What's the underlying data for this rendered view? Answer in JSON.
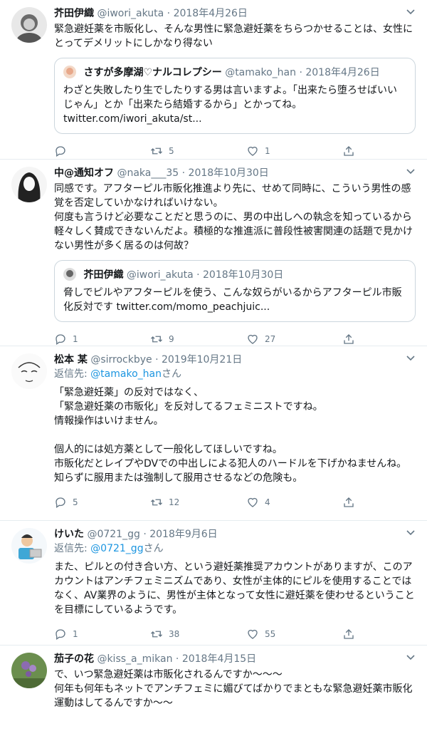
{
  "colors": {
    "text": "#14171a",
    "muted": "#657786",
    "link": "#1b95e0",
    "border": "#e6ecf0"
  },
  "tweets": [
    {
      "name": "芥田伊織",
      "handle": "@iwori_akuta",
      "date": "2018年4月26日",
      "reply_to": null,
      "body": "緊急避妊薬を市販化し、そんな男性に緊急避妊薬をちらつかせることは、女性にとってデメリットにしかなり得ない",
      "quote": {
        "name": "さすが多摩湖♡ナルコレプシー",
        "handle": "@tamako_han",
        "date": "2018年4月26日",
        "body": "わざと失敗したり生でしたりする男は言いますよ。「出来たら堕ろせばいいじゃん」とか「出来たら結婚するから」とかってね。\ntwitter.com/iwori_akuta/st..."
      },
      "counts": {
        "reply": "",
        "retweet": "5",
        "like": "1"
      }
    },
    {
      "name": "中@通知オフ",
      "handle": "@naka___35",
      "date": "2018年10月30日",
      "reply_to": null,
      "body": "同感です。アフターピル市販化推進より先に、せめて同時に、こういう男性の感覚を否定していかなければいけない。\n何度も言うけど必要なことだと思うのに、男の中出しへの執念を知っているから軽々しく賛成できないんだよ。積極的な推進派に普段性被害関連の話題で見かけない男性が多く居るのは何故？",
      "quote": {
        "name": "芥田伊織",
        "handle": "@iwori_akuta",
        "date": "2018年10月30日",
        "body": "脅しでピルやアフターピルを使う、こんな奴らがいるからアフターピル市販化反対です twitter.com/momo_peachjuic..."
      },
      "counts": {
        "reply": "1",
        "retweet": "9",
        "like": "27"
      }
    },
    {
      "name": "松本 某",
      "handle": "@sirrockbye",
      "date": "2019年10月21日",
      "reply_to": {
        "prefix": "返信先: ",
        "target": "@tamako_han",
        "suffix": "さん"
      },
      "body": "「緊急避妊薬」の反対ではなく、\n「緊急避妊薬の市販化」を反対してるフェミニストですね。\n情報操作はいけません。\n\n個人的には処方薬として一般化してほしいですね。\n市販化だとレイプやDVでの中出しによる犯人のハードルを下げかねませんね。\n知らずに服用または強制して服用させるなどの危険も。",
      "quote": null,
      "counts": {
        "reply": "5",
        "retweet": "12",
        "like": "4"
      }
    },
    {
      "name": "けいた",
      "handle": "@0721_gg",
      "date": "2018年9月6日",
      "reply_to": {
        "prefix": "返信先: ",
        "target": "@0721_gg",
        "suffix": "さん"
      },
      "body": "また、ピルとの付き合い方、という避妊薬推奨アカウントがありますが、このアカウントはアンチフェミニズムであり、女性が主体的にピルを使用することではなく、AV業界のように、男性が主体となって女性に避妊薬を使わせるということを目標にしているようです。",
      "quote": null,
      "counts": {
        "reply": "1",
        "retweet": "38",
        "like": "55"
      }
    },
    {
      "name": "茄子の花",
      "handle": "@kiss_a_mikan",
      "date": "2018年4月15日",
      "reply_to": null,
      "body": "で、いつ緊急避妊薬は市販化されるんですか〜〜〜\n何年も何年もネットでアンチフェミに媚びてばかりでまともな緊急避妊薬市販化運動はしてるんですか〜〜",
      "quote": null,
      "counts": {
        "reply": "",
        "retweet": "",
        "like": ""
      }
    }
  ],
  "icons": {
    "reply": "reply-icon",
    "retweet": "retweet-icon",
    "like": "heart-icon",
    "share": "share-icon",
    "menu": "chevron-down-icon"
  }
}
